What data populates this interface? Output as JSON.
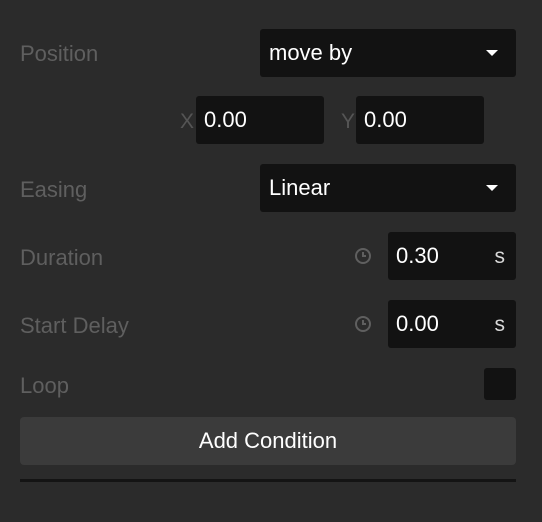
{
  "position": {
    "label": "Position",
    "mode": "move by",
    "x_label": "X",
    "x_value": "0.00",
    "y_label": "Y",
    "y_value": "0.00"
  },
  "easing": {
    "label": "Easing",
    "value": "Linear"
  },
  "duration": {
    "label": "Duration",
    "value": "0.30",
    "unit": "s"
  },
  "start_delay": {
    "label": "Start Delay",
    "value": "0.00",
    "unit": "s"
  },
  "loop": {
    "label": "Loop",
    "checked": false
  },
  "add_condition": {
    "label": "Add Condition"
  },
  "icons": {
    "dropdown": "caret-down-icon",
    "time": "clock-icon"
  },
  "colors": {
    "background": "#2b2b2b",
    "field": "#121212",
    "label": "#5f5f5f",
    "button": "#3b3b3b",
    "text": "#ffffff"
  }
}
